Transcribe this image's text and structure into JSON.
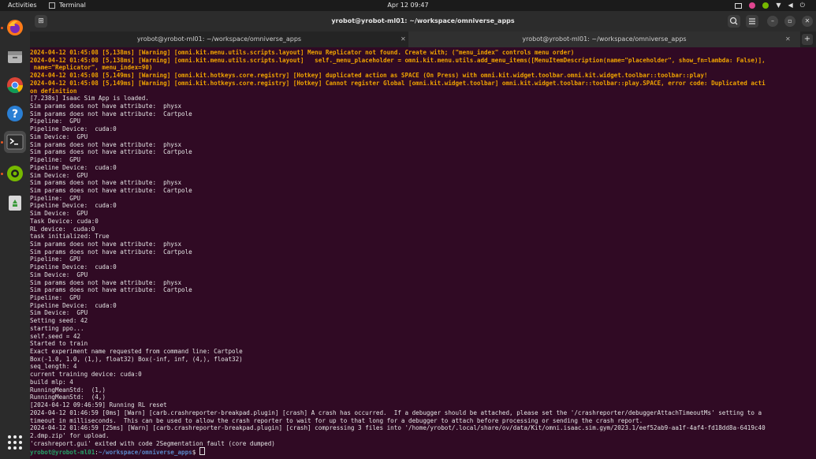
{
  "topbar": {
    "activities": "Activities",
    "app_name": "Terminal",
    "clock": "Apr 12  09:47"
  },
  "dock": {
    "apps": [
      "firefox-icon",
      "files-icon",
      "chrome-icon",
      "help-icon",
      "terminal-icon",
      "nvidia-icon",
      "trash-icon"
    ]
  },
  "window": {
    "title": "yrobot@yrobot-ml01: ~/workspace/omniverse_apps",
    "tabs": [
      {
        "label": "yrobot@yrobot-ml01: ~/workspace/omniverse_apps"
      },
      {
        "label": "yrobot@yrobot-ml01: ~/workspace/omniverse_apps"
      }
    ]
  },
  "terminal": {
    "lines": [
      {
        "cls": "warn",
        "text": "2024-04-12 01:45:08 [5,138ms] [Warning] [omni.kit.menu.utils.scripts.layout] Menu Replicator not found. Create with; (\"menu_index\" controls menu order)"
      },
      {
        "cls": "warn",
        "text": "2024-04-12 01:45:08 [5,138ms] [Warning] [omni.kit.menu.utils.scripts.layout]   self._menu_placeholder = omni.kit.menu.utils.add_menu_items([MenuItemDescription(name=\"placeholder\", show_fn=lambda: False)],"
      },
      {
        "cls": "warn",
        "text": " name=\"Replicator\", menu_index=90)"
      },
      {
        "cls": "warn",
        "text": "2024-04-12 01:45:08 [5,149ms] [Warning] [omni.kit.hotkeys.core.registry] [Hotkey] duplicated action as SPACE (On Press) with omni.kit.widget.toolbar.omni.kit.widget.toolbar::toolbar::play!"
      },
      {
        "cls": "warn",
        "text": "2024-04-12 01:45:08 [5,149ms] [Warning] [omni.kit.hotkeys.core.registry] [Hotkey] Cannot register Global [omni.kit.widget.toolbar] omni.kit.widget.toolbar::toolbar::play.SPACE, error code: Duplicated acti"
      },
      {
        "cls": "warn",
        "text": "on definition"
      },
      {
        "cls": "",
        "text": "[7.238s] Isaac Sim App is loaded."
      },
      {
        "cls": "",
        "text": "Sim params does not have attribute:  physx"
      },
      {
        "cls": "",
        "text": "Sim params does not have attribute:  Cartpole"
      },
      {
        "cls": "",
        "text": "Pipeline:  GPU"
      },
      {
        "cls": "",
        "text": "Pipeline Device:  cuda:0"
      },
      {
        "cls": "",
        "text": "Sim Device:  GPU"
      },
      {
        "cls": "",
        "text": "Sim params does not have attribute:  physx"
      },
      {
        "cls": "",
        "text": "Sim params does not have attribute:  Cartpole"
      },
      {
        "cls": "",
        "text": "Pipeline:  GPU"
      },
      {
        "cls": "",
        "text": "Pipeline Device:  cuda:0"
      },
      {
        "cls": "",
        "text": "Sim Device:  GPU"
      },
      {
        "cls": "",
        "text": "Sim params does not have attribute:  physx"
      },
      {
        "cls": "",
        "text": "Sim params does not have attribute:  Cartpole"
      },
      {
        "cls": "",
        "text": "Pipeline:  GPU"
      },
      {
        "cls": "",
        "text": "Pipeline Device:  cuda:0"
      },
      {
        "cls": "",
        "text": "Sim Device:  GPU"
      },
      {
        "cls": "",
        "text": "Task Device: cuda:0"
      },
      {
        "cls": "",
        "text": "RL device:  cuda:0"
      },
      {
        "cls": "",
        "text": "task initialized: True"
      },
      {
        "cls": "",
        "text": "Sim params does not have attribute:  physx"
      },
      {
        "cls": "",
        "text": "Sim params does not have attribute:  Cartpole"
      },
      {
        "cls": "",
        "text": "Pipeline:  GPU"
      },
      {
        "cls": "",
        "text": "Pipeline Device:  cuda:0"
      },
      {
        "cls": "",
        "text": "Sim Device:  GPU"
      },
      {
        "cls": "",
        "text": "Sim params does not have attribute:  physx"
      },
      {
        "cls": "",
        "text": "Sim params does not have attribute:  Cartpole"
      },
      {
        "cls": "",
        "text": "Pipeline:  GPU"
      },
      {
        "cls": "",
        "text": "Pipeline Device:  cuda:0"
      },
      {
        "cls": "",
        "text": "Sim Device:  GPU"
      },
      {
        "cls": "",
        "text": "Setting seed: 42"
      },
      {
        "cls": "",
        "text": "starting ppo..."
      },
      {
        "cls": "",
        "text": "self.seed = 42"
      },
      {
        "cls": "",
        "text": "Started to train"
      },
      {
        "cls": "",
        "text": "Exact experiment name requested from command line: Cartpole"
      },
      {
        "cls": "",
        "text": "Box(-1.0, 1.0, (1,), float32) Box(-inf, inf, (4,), float32)"
      },
      {
        "cls": "",
        "text": "seq_length: 4"
      },
      {
        "cls": "",
        "text": "current training device: cuda:0"
      },
      {
        "cls": "",
        "text": "build mlp: 4"
      },
      {
        "cls": "",
        "text": "RunningMeanStd:  (1,)"
      },
      {
        "cls": "",
        "text": "RunningMeanStd:  (4,)"
      },
      {
        "cls": "",
        "text": "[2024-04-12 09:46:59] Running RL reset"
      },
      {
        "cls": "",
        "text": "2024-04-12 01:46:59 [0ms] [Warn] [carb.crashreporter-breakpad.plugin] [crash] A crash has occurred.  If a debugger should be attached, please set the '/crashreporter/debuggerAttachTimeoutMs' setting to a"
      },
      {
        "cls": "",
        "text": "timeout in milliseconds.  This can be used to allow the crash reporter to wait for up to that long for a debugger to attach before processing or sending the crash report."
      },
      {
        "cls": "",
        "text": "2024-04-12 01:46:59 [25ms] [Warn] [carb.crashreporter-breakpad.plugin] [crash] compressing 3 files into '/home/yrobot/.local/share/ov/data/Kit/omni.isaac.sim.gym/2023.1/eef52ab9-aa1f-4af4-fd18dd8a-6419c40"
      },
      {
        "cls": "",
        "text": "2.dmp.zip' for upload."
      },
      {
        "cls": "",
        "text": "'crashreport.gui' exited with code 2Segmentation fault (core dumped)"
      }
    ],
    "prompt_user": "yrobot@yrobot-ml01",
    "prompt_sep": ":",
    "prompt_path": "~/workspace/omniverse_apps",
    "prompt_symbol": "$ "
  }
}
